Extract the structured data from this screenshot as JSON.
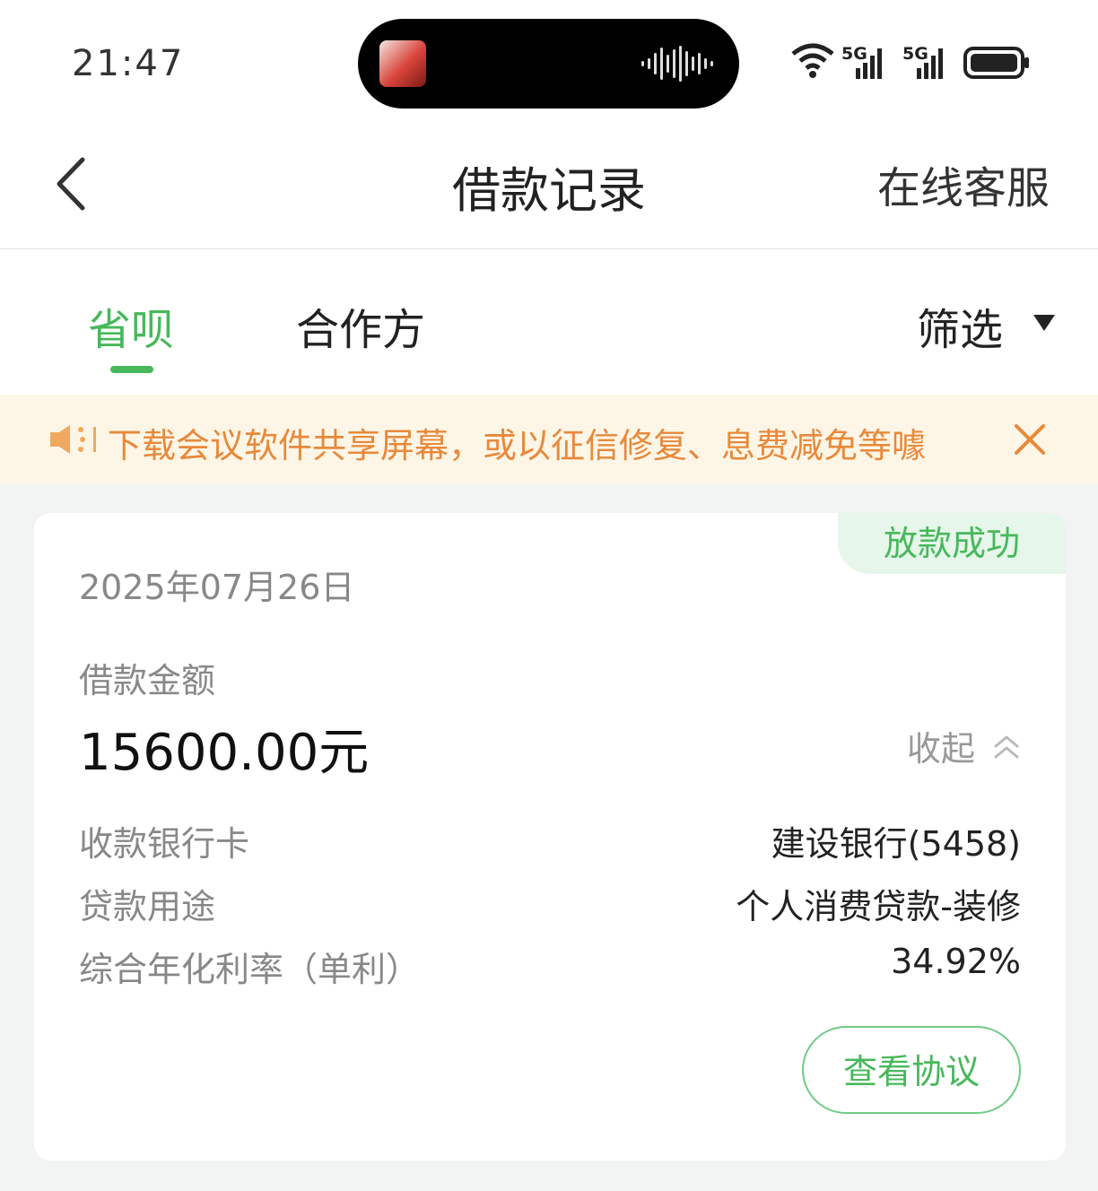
{
  "status_bar": {
    "time": "21:47",
    "network_1": "5G",
    "network_2": "5G"
  },
  "nav": {
    "title": "借款记录",
    "service": "在线客服"
  },
  "tabs": {
    "items": [
      {
        "label": "省呗",
        "active": true
      },
      {
        "label": "合作方",
        "active": false
      }
    ],
    "filter": "筛选"
  },
  "notice": {
    "text": "下载会议软件共享屏幕，或以征信修复、息费减免等噱"
  },
  "card": {
    "status": "放款成功",
    "date": "2025年07月26日",
    "amount_label": "借款金额",
    "amount": "15600.00元",
    "collapse": "收起",
    "rows": [
      {
        "label": "收款银行卡",
        "value": "建设银行(5458)"
      },
      {
        "label": "贷款用途",
        "value": "个人消费贷款-装修"
      },
      {
        "label": "综合年化利率（单利）",
        "value": "34.92%"
      }
    ],
    "agreement_button": "查看协议"
  },
  "colors": {
    "accent": "#47b85b",
    "notice_bg": "#fdf6e6",
    "notice_text": "#e8893b"
  },
  "icons": [
    "back-arrow-icon",
    "chevron-up-double-icon",
    "speaker-icon",
    "close-icon",
    "wifi-icon",
    "signal-icon",
    "battery-icon"
  ]
}
